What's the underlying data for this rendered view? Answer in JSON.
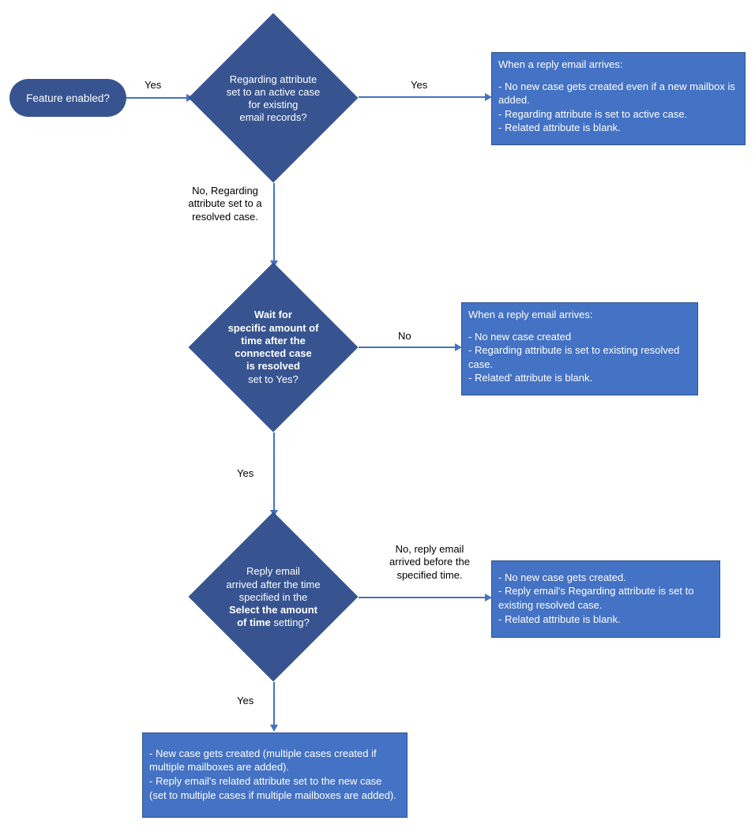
{
  "terminator": {
    "text": "Feature enabled?"
  },
  "decision1": {
    "line1": "Regarding attribute",
    "line2": "set to an active case",
    "line3": "for existing",
    "line4": "email records?"
  },
  "decision2": {
    "line1": "Wait for",
    "line2": "specific amount of",
    "line3": "time after the",
    "line4": "connected case",
    "line5": "is resolved",
    "line6": "set to Yes?"
  },
  "decision3": {
    "line1": "Reply email",
    "line2": "arrived after the time",
    "line3": "specified in the",
    "line4": "Select the amount",
    "line5": "of time",
    "line5b": " setting?"
  },
  "process1": {
    "title": "When a reply email arrives:",
    "bullet1": "- No new case gets created even if a new mailbox is added.",
    "bullet2": "- Regarding attribute is set to active case.",
    "bullet3": "- Related attribute is blank."
  },
  "process2": {
    "title": "When a reply email arrives:",
    "bullet1": "- No new case created",
    "bullet2": "- Regarding attribute is set to existing resolved case.",
    "bullet3": "- Related' attribute is blank."
  },
  "process3": {
    "bullet1": "- No new case gets created.",
    "bullet2": "- Reply email's Regarding attribute is set to existing resolved case.",
    "bullet3": "- Related attribute is blank."
  },
  "process4": {
    "bullet1": "- New case gets created (multiple cases created if multiple mailboxes are added).",
    "bullet2": "- Reply email's related attribute set to the new case (set to multiple cases if multiple mailboxes are added)."
  },
  "labels": {
    "yes": "Yes",
    "no": "No",
    "d1_no": "No, Regarding attribute set to a resolved case.",
    "d3_no": "No, reply email arrived before the specified time."
  }
}
